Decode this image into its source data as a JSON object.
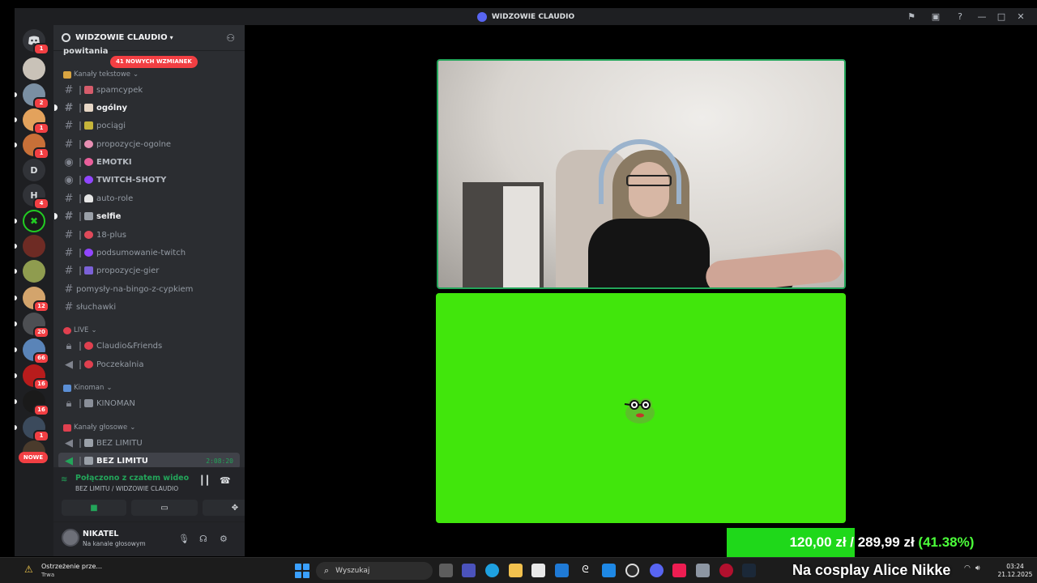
{
  "window": {
    "title": "WIDZOWIE CLAUDIO",
    "icons": [
      "flag-icon",
      "inbox-icon",
      "help-icon",
      "minimize-icon",
      "maximize-icon",
      "close-icon"
    ]
  },
  "rail": {
    "servers": [
      {
        "label": "",
        "badge": "1",
        "icon": "discord-home-icon"
      },
      {
        "label": "",
        "badge": "",
        "icon": "avatar"
      },
      {
        "label": "",
        "badge": "2",
        "icon": "server-icon"
      },
      {
        "label": "",
        "badge": "1",
        "icon": "server-icon"
      },
      {
        "label": "",
        "badge": "1",
        "icon": "server-icon"
      },
      {
        "label": "D",
        "badge": "",
        "icon": ""
      },
      {
        "label": "H",
        "badge": "4",
        "icon": ""
      },
      {
        "label": "",
        "badge": "",
        "icon": "server-icon"
      },
      {
        "label": "",
        "badge": "",
        "icon": "server-icon"
      },
      {
        "label": "",
        "badge": "",
        "icon": "server-icon"
      },
      {
        "label": "",
        "badge": "12",
        "icon": "server-icon"
      },
      {
        "label": "",
        "badge": "20",
        "icon": "server-icon"
      },
      {
        "label": "",
        "badge": "66",
        "icon": "server-icon"
      },
      {
        "label": "",
        "badge": "16",
        "icon": "server-icon"
      },
      {
        "label": "",
        "badge": "16",
        "icon": "server-icon"
      },
      {
        "label": "",
        "badge": "1",
        "icon": "server-icon"
      }
    ],
    "new_label": "NOWE"
  },
  "sidebar": {
    "server_name": "WIDZOWIE CLAUDIO",
    "mentions_pill": "41 NOWYCH WZMIANEK",
    "partial_channel": "powitania",
    "categories": {
      "text": "Kanały tekstowe",
      "live": "LIVE",
      "kinoman": "Kinoman",
      "voice": "Kanały głosowe"
    },
    "text_channels": [
      {
        "name": "spamcypek",
        "bold": false
      },
      {
        "name": "ogólny",
        "bold": true
      },
      {
        "name": "pociągi",
        "bold": false
      },
      {
        "name": "propozycje-ogolne",
        "bold": false
      },
      {
        "name": "EMOTKI",
        "bold": false
      },
      {
        "name": "TWITCH-SHOTY",
        "bold": false
      },
      {
        "name": "auto-role",
        "bold": false
      },
      {
        "name": "selfie",
        "bold": true
      },
      {
        "name": "18-plus",
        "bold": false
      },
      {
        "name": "podsumowanie-twitch",
        "bold": false
      },
      {
        "name": "propozycje-gier",
        "bold": false
      },
      {
        "name": "pomysły-na-bingo-z-cypkiem",
        "bold": false
      },
      {
        "name": "słuchawki",
        "bold": false
      }
    ],
    "live_channels": [
      "Claudio&Friends",
      "Poczekalnia"
    ],
    "kinoman_channels": [
      "KINOMAN"
    ],
    "voice_channels": [
      {
        "name": "BEZ LIMITU",
        "time": ""
      },
      {
        "name": "BEZ LIMITU",
        "time": "2:08:20"
      }
    ]
  },
  "voice_panel": {
    "status": "Połączono z czatem wideo",
    "location": "BEZ LIMITU / WIDZOWIE CLAUDIO"
  },
  "user_panel": {
    "username": "NIKATEL",
    "status": "Na kanale głosowym"
  },
  "overlay": {
    "donation_text_current": "120,00 zł",
    "donation_text_sep": " / ",
    "donation_text_goal": "289,99 zł",
    "donation_text_pct": "(41.38%)",
    "donation_current": 120.0,
    "donation_goal": 289.99,
    "donation_fraction": 0.4138,
    "caption": "Na cosplay Alice Nikke"
  },
  "taskbar": {
    "warning_title": "Ostrzeżenie prze...",
    "warning_sub": "Trwa",
    "search_placeholder": "Wyszukaj",
    "time": "03:24",
    "date": "21.12.2025"
  },
  "colors": {
    "accent_green": "#23a55a",
    "greenscreen": "#41e60c",
    "badge_red": "#f23f43",
    "blurple": "#5865f2"
  }
}
